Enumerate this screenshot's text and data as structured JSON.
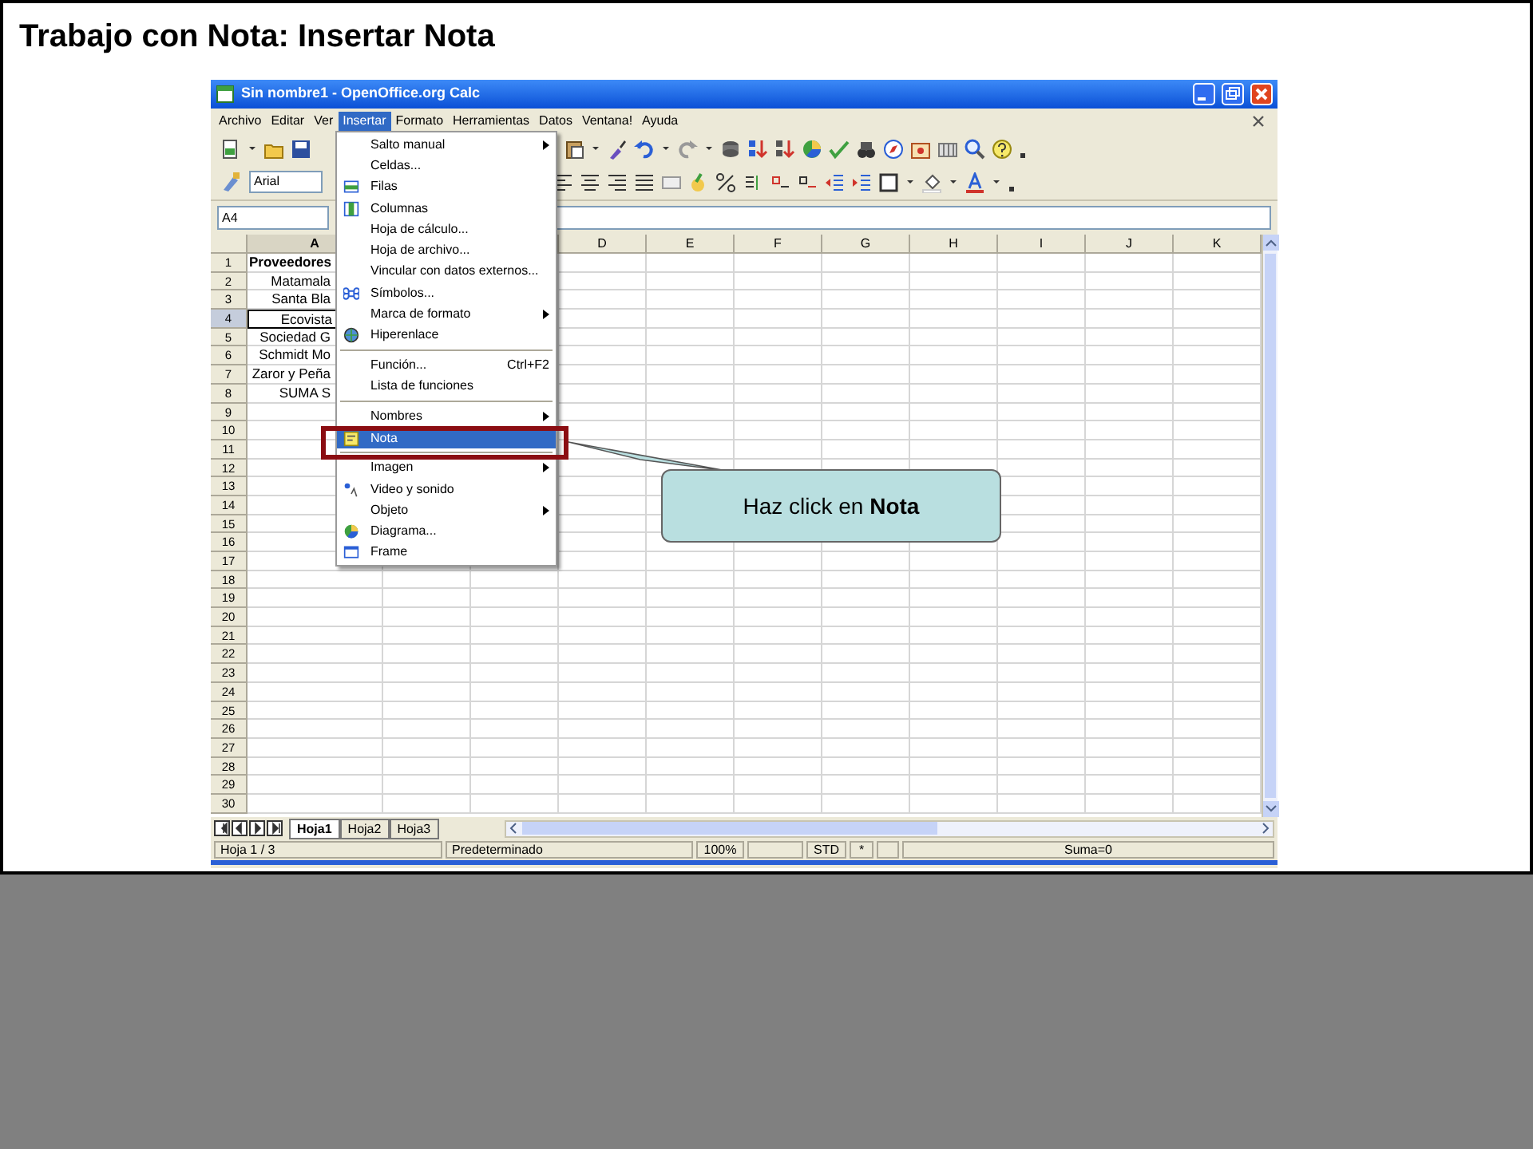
{
  "slide_title": "Trabajo con Nota: Insertar Nota",
  "window": {
    "title": "Sin nombre1 - OpenOffice.org Calc"
  },
  "menu_bar": [
    {
      "label": "Archivo",
      "selected": false
    },
    {
      "label": "Editar",
      "selected": false
    },
    {
      "label": "Ver",
      "selected": false
    },
    {
      "label": "Insertar",
      "selected": true
    },
    {
      "label": "Formato",
      "selected": false
    },
    {
      "label": "Herramientas",
      "selected": false
    },
    {
      "label": "Datos",
      "selected": false
    },
    {
      "label": "Ventana!",
      "selected": false
    },
    {
      "label": "Ayuda",
      "selected": false
    }
  ],
  "toolbar": {
    "font_name": "Arial"
  },
  "formula_bar": {
    "name_box": "A4"
  },
  "columns": [
    {
      "label": "A",
      "selected": true
    },
    {},
    {},
    {
      "label": "D",
      "selected": false
    },
    {
      "label": "E",
      "selected": false
    },
    {
      "label": "F",
      "selected": false
    },
    {
      "label": "G",
      "selected": false
    },
    {
      "label": "H",
      "selected": false
    },
    {
      "label": "I",
      "selected": false
    },
    {
      "label": "J",
      "selected": false
    },
    {
      "label": "K",
      "selected": false
    }
  ],
  "rows": [
    {
      "label": "1",
      "selected": false,
      "bold": true,
      "cell_a": "Proveedores"
    },
    {
      "label": "2",
      "selected": false,
      "bold": false,
      "cell_a": "Matamala"
    },
    {
      "label": "3",
      "selected": false,
      "bold": false,
      "cell_a": "Santa Bla"
    },
    {
      "label": "4",
      "selected": true,
      "bold": false,
      "cell_a": "Ecovista"
    },
    {
      "label": "5",
      "selected": false,
      "bold": false,
      "cell_a": "Sociedad G"
    },
    {
      "label": "6",
      "selected": false,
      "bold": false,
      "cell_a": "Schmidt Mo"
    },
    {
      "label": "7",
      "selected": false,
      "bold": false,
      "cell_a": "Zaror y Peña"
    },
    {
      "label": "8",
      "selected": false,
      "bold": false,
      "cell_a": "SUMA S"
    },
    {
      "label": "9",
      "selected": false
    },
    {
      "label": "10",
      "selected": false
    },
    {
      "label": "11",
      "selected": false
    },
    {
      "label": "12",
      "selected": false
    },
    {
      "label": "13",
      "selected": false
    },
    {
      "label": "14",
      "selected": false
    },
    {
      "label": "15",
      "selected": false
    },
    {
      "label": "16",
      "selected": false
    },
    {
      "label": "17",
      "selected": false
    },
    {
      "label": "18",
      "selected": false
    },
    {
      "label": "19",
      "selected": false
    },
    {
      "label": "20",
      "selected": false
    },
    {
      "label": "21",
      "selected": false
    },
    {
      "label": "22",
      "selected": false
    },
    {
      "label": "23",
      "selected": false
    },
    {
      "label": "24",
      "selected": false
    },
    {
      "label": "25",
      "selected": false
    },
    {
      "label": "26",
      "selected": false
    },
    {
      "label": "27",
      "selected": false
    },
    {
      "label": "28",
      "selected": false
    },
    {
      "label": "29",
      "selected": false
    },
    {
      "label": "30",
      "selected": false
    }
  ],
  "insert_menu": [
    {
      "kind": "item",
      "label": "Salto manual",
      "submenu": true,
      "selected": false
    },
    {
      "kind": "item",
      "label": "Celdas...",
      "submenu": false,
      "selected": false
    },
    {
      "kind": "item",
      "label": "Filas",
      "submenu": false,
      "selected": false
    },
    {
      "kind": "item",
      "label": "Columnas",
      "submenu": false,
      "selected": false
    },
    {
      "kind": "item",
      "label": "Hoja de cálculo...",
      "submenu": false,
      "selected": false
    },
    {
      "kind": "item",
      "label": "Hoja de archivo...",
      "submenu": false,
      "selected": false
    },
    {
      "kind": "item",
      "label": "Vincular con datos externos...",
      "submenu": false,
      "selected": false
    },
    {
      "kind": "item",
      "label": "Símbolos...",
      "submenu": false,
      "selected": false
    },
    {
      "kind": "item",
      "label": "Marca de formato",
      "submenu": true,
      "selected": false
    },
    {
      "kind": "item",
      "label": "Hiperenlace",
      "submenu": false,
      "selected": false
    },
    {
      "kind": "separator"
    },
    {
      "kind": "item",
      "label": "Función...",
      "shortcut": "Ctrl+F2",
      "submenu": false,
      "selected": false
    },
    {
      "kind": "item",
      "label": "Lista de funciones",
      "submenu": false,
      "selected": false
    },
    {
      "kind": "separator"
    },
    {
      "kind": "item",
      "label": "Nombres",
      "submenu": true,
      "selected": false
    },
    {
      "kind": "item",
      "label": "Nota",
      "submenu": false,
      "selected": true
    },
    {
      "kind": "separator"
    },
    {
      "kind": "item",
      "label": "Imagen",
      "submenu": true,
      "selected": false
    },
    {
      "kind": "item",
      "label": "Video y sonido",
      "submenu": false,
      "selected": false
    },
    {
      "kind": "item",
      "label": "Objeto",
      "submenu": true,
      "selected": false
    },
    {
      "kind": "item",
      "label": "Diagrama...",
      "submenu": false,
      "selected": false
    },
    {
      "kind": "item",
      "label": "Frame",
      "submenu": false,
      "selected": false
    }
  ],
  "sheet_tabs": [
    {
      "label": "Hoja1",
      "selected": true
    },
    {
      "label": "Hoja2",
      "selected": false
    },
    {
      "label": "Hoja3",
      "selected": false
    }
  ],
  "status_bar": [
    "Hoja 1 / 3",
    "Predeterminado",
    "100%",
    "STD",
    "*",
    "Suma=0"
  ],
  "callout": {
    "text": "Haz click en **Nota**"
  }
}
